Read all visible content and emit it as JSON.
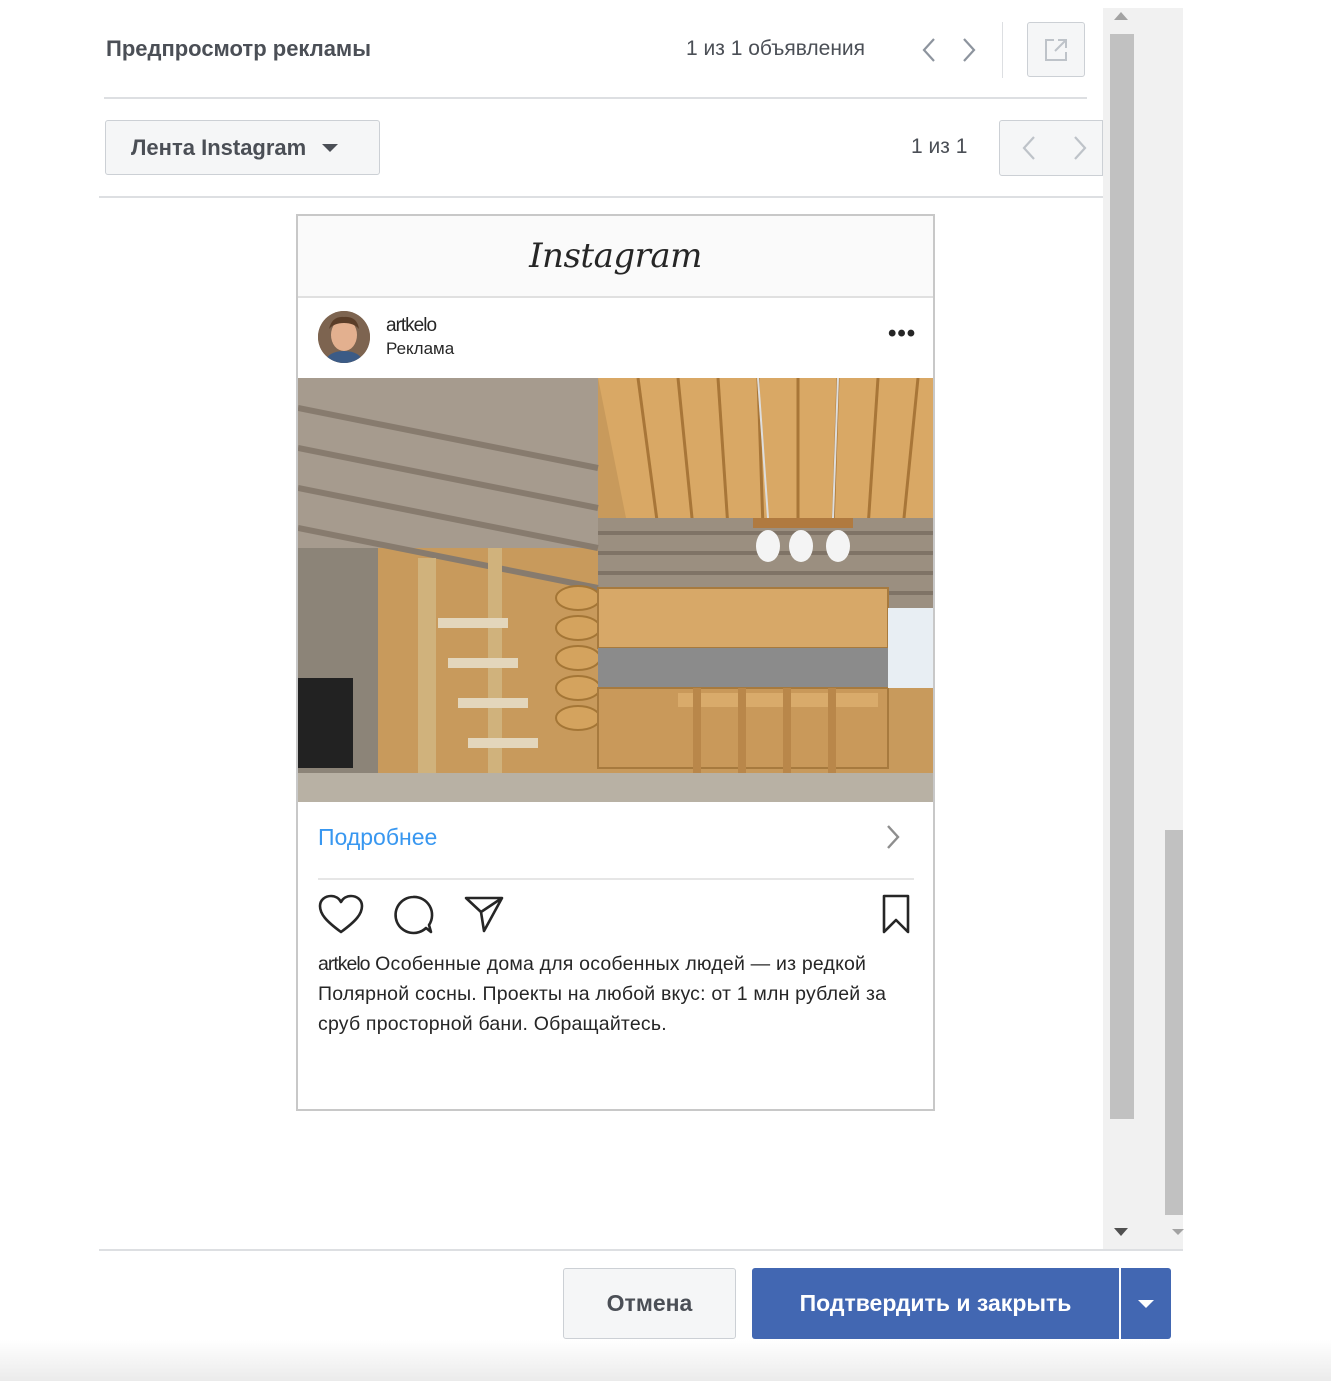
{
  "header": {
    "title": "Предпросмотр рекламы",
    "ad_counter": "1 из 1 объявления"
  },
  "placement": {
    "selected": "Лента Instagram",
    "counter": "1 из 1"
  },
  "post": {
    "platform_logo": "Instagram",
    "username": "artkelo",
    "sponsored_label": "Реклама",
    "cta_label": "Подробнее",
    "caption_username": "artkelo",
    "caption_text": "Особенные дома для особенных людей — из редкой Полярной сосны. Проекты на любой вкус: от 1 млн рублей за сруб просторной бани. Обращайтесь.",
    "more_icon": "more-horizontal-icon",
    "action_icons": [
      "heart-icon",
      "comment-icon",
      "share-icon",
      "bookmark-icon"
    ]
  },
  "footer": {
    "cancel_label": "Отмена",
    "confirm_label": "Подтвердить и закрыть"
  },
  "colors": {
    "primary_button": "#4267b2",
    "cta_link": "#3897f0",
    "text": "#4b4f56"
  }
}
